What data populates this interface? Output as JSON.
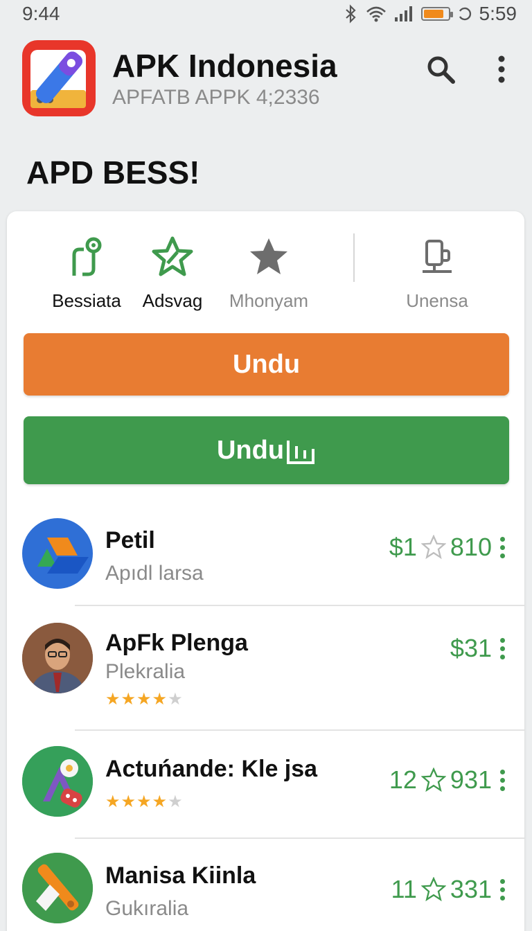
{
  "status_bar": {
    "time_left": "9:44",
    "time_right": "5:59",
    "battery_level": 0.85,
    "battery_color": "#f08a1c"
  },
  "header": {
    "app_icon": "toolbox-app-icon",
    "title": "APK Indonesia",
    "subtitle": "APFATB APPK 4;2336",
    "search_icon": "search-icon",
    "menu_icon": "more-vert-icon"
  },
  "section": {
    "title": "APD BESS!"
  },
  "quick_actions": [
    {
      "icon": "git-branch-icon",
      "label": "Bessiata",
      "color": "#3f9a4d",
      "muted": false
    },
    {
      "icon": "star-sparkle-icon",
      "label": "Adsvag",
      "color": "#3f9a4d",
      "muted": false
    },
    {
      "icon": "star-icon",
      "label": "Mhonyam",
      "color": "#6d6d6d",
      "muted": true
    },
    {
      "icon": "device-icon",
      "label": "Unensa",
      "color": "#6d6d6d",
      "muted": true
    }
  ],
  "buttons": {
    "primary_label": "Undu",
    "secondary_label": "Undu",
    "secondary_icon": "bar-chart-icon",
    "primary_color": "#e87c32",
    "secondary_color": "#3f9a4d"
  },
  "apps": [
    {
      "icon": "drive-logo-icon",
      "title": "Petil",
      "subtitle": "Apıdl larsa",
      "rating_stars": null,
      "price": "$1",
      "show_star": true,
      "count": "810"
    },
    {
      "icon": "person-avatar",
      "title": "ApFk Plenga",
      "subtitle": "Plekralia",
      "rating_stars": 3.5,
      "price": "$31",
      "show_star": false,
      "count": ""
    },
    {
      "icon": "maps-logo-icon",
      "title": "Actuńande: Kle jsa",
      "subtitle": "",
      "rating_stars": 3.5,
      "price": "12",
      "show_star": true,
      "count": "931"
    },
    {
      "icon": "tools-logo-icon",
      "title": "Manisa Kiinla",
      "subtitle": "Gukıralia",
      "rating_stars": null,
      "price": "11",
      "show_star": true,
      "count": "331"
    }
  ],
  "colors": {
    "accent_green": "#3f9a4d",
    "star_gold": "#f5a623",
    "star_gray": "#cfcfcf"
  }
}
